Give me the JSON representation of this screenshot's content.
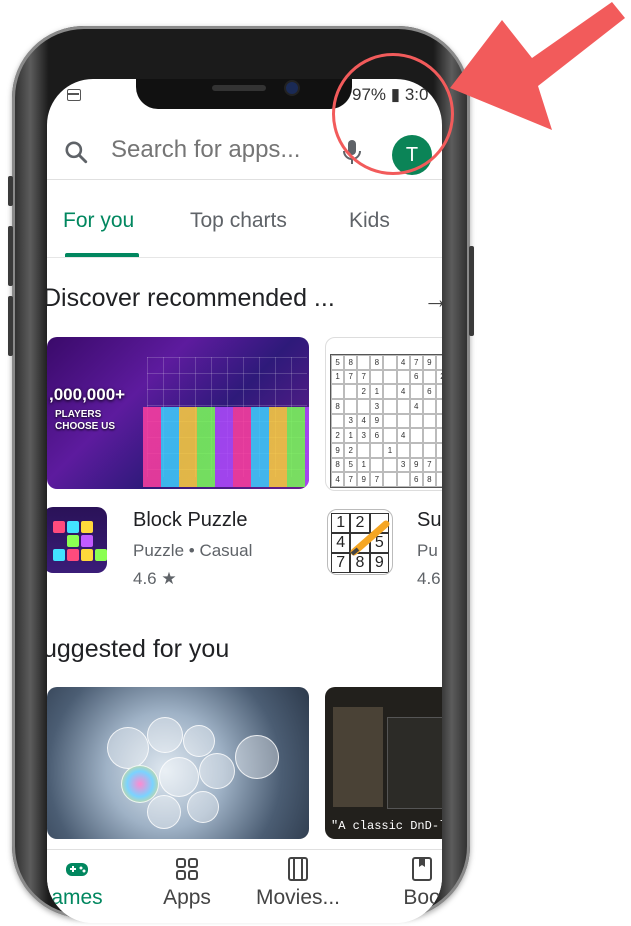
{
  "status": {
    "battery_time": "97% ▮ 3:0"
  },
  "search": {
    "placeholder": "Search for apps...",
    "avatar_letter": "T"
  },
  "tabs": [
    {
      "label": "For you",
      "active": true
    },
    {
      "label": "Top charts",
      "active": false
    },
    {
      "label": "Kids",
      "active": false
    }
  ],
  "sections": {
    "recommended": "Discover recommended ...",
    "suggested": "uggested for you"
  },
  "banner1": {
    "count": ",000,000+",
    "line1": "PLAYERS",
    "line2": "CHOOSE US"
  },
  "apps": [
    {
      "name": "Block Puzzle",
      "category": "Puzzle",
      "subcategory": "Casual",
      "rating": "4.6"
    },
    {
      "name": "Su",
      "category": "Pu",
      "rating": "4.6"
    }
  ],
  "banner4_caption": "\"A classic DnD-like",
  "sudoku_icon_digits": [
    "1",
    "2",
    "",
    "4",
    "",
    "5",
    "7",
    "8",
    "9"
  ],
  "bottom_nav": [
    {
      "label": "ames",
      "icon": "gamepad-icon",
      "active": true
    },
    {
      "label": "Apps",
      "icon": "apps-grid-icon",
      "active": false
    },
    {
      "label": "Movies...",
      "icon": "film-icon",
      "active": false
    },
    {
      "label": "Boo",
      "icon": "book-icon",
      "active": false
    }
  ],
  "colors": {
    "accent": "#01875f",
    "annotation": "#f25b5b"
  }
}
